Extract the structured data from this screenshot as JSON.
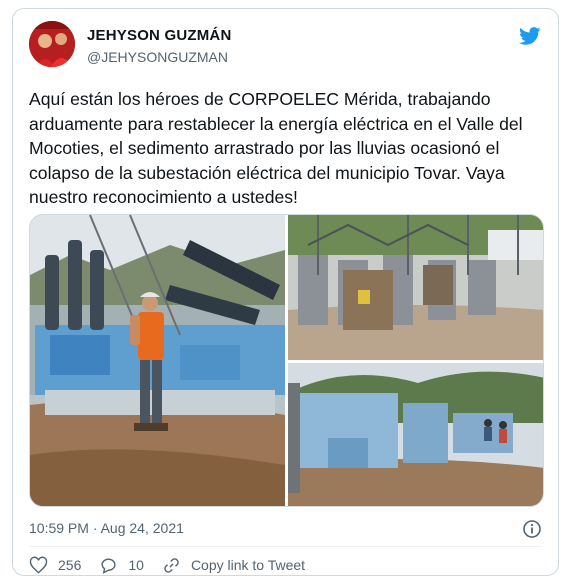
{
  "tweet": {
    "author_name": "JEHYSON GUZMÁN",
    "author_handle": "@JEHYSONGUZMAN",
    "text": "Aquí están los héroes de CORPOELEC Mérida, trabajando arduamente para restablecer la energía eléctrica en el Valle del Mocoties, el sedimento arrastrado por las lluvias ocasionó el colapso de la subestación eléctrica del municipio Tovar. Vaya nuestro reconocimiento a ustedes!",
    "timestamp": "10:59 PM · Aug 24, 2021",
    "likes": "256",
    "replies": "10",
    "copy_link_label": "Copy link to Tweet"
  },
  "icons": {
    "brand": "twitter-bird-icon",
    "info": "info-icon",
    "like": "heart-icon",
    "reply": "reply-bubble-icon",
    "copy": "link-icon"
  },
  "colors": {
    "brand": "#1d9bf0",
    "text": "#0f1419",
    "secondary": "#536471",
    "border": "#cfd9de"
  }
}
